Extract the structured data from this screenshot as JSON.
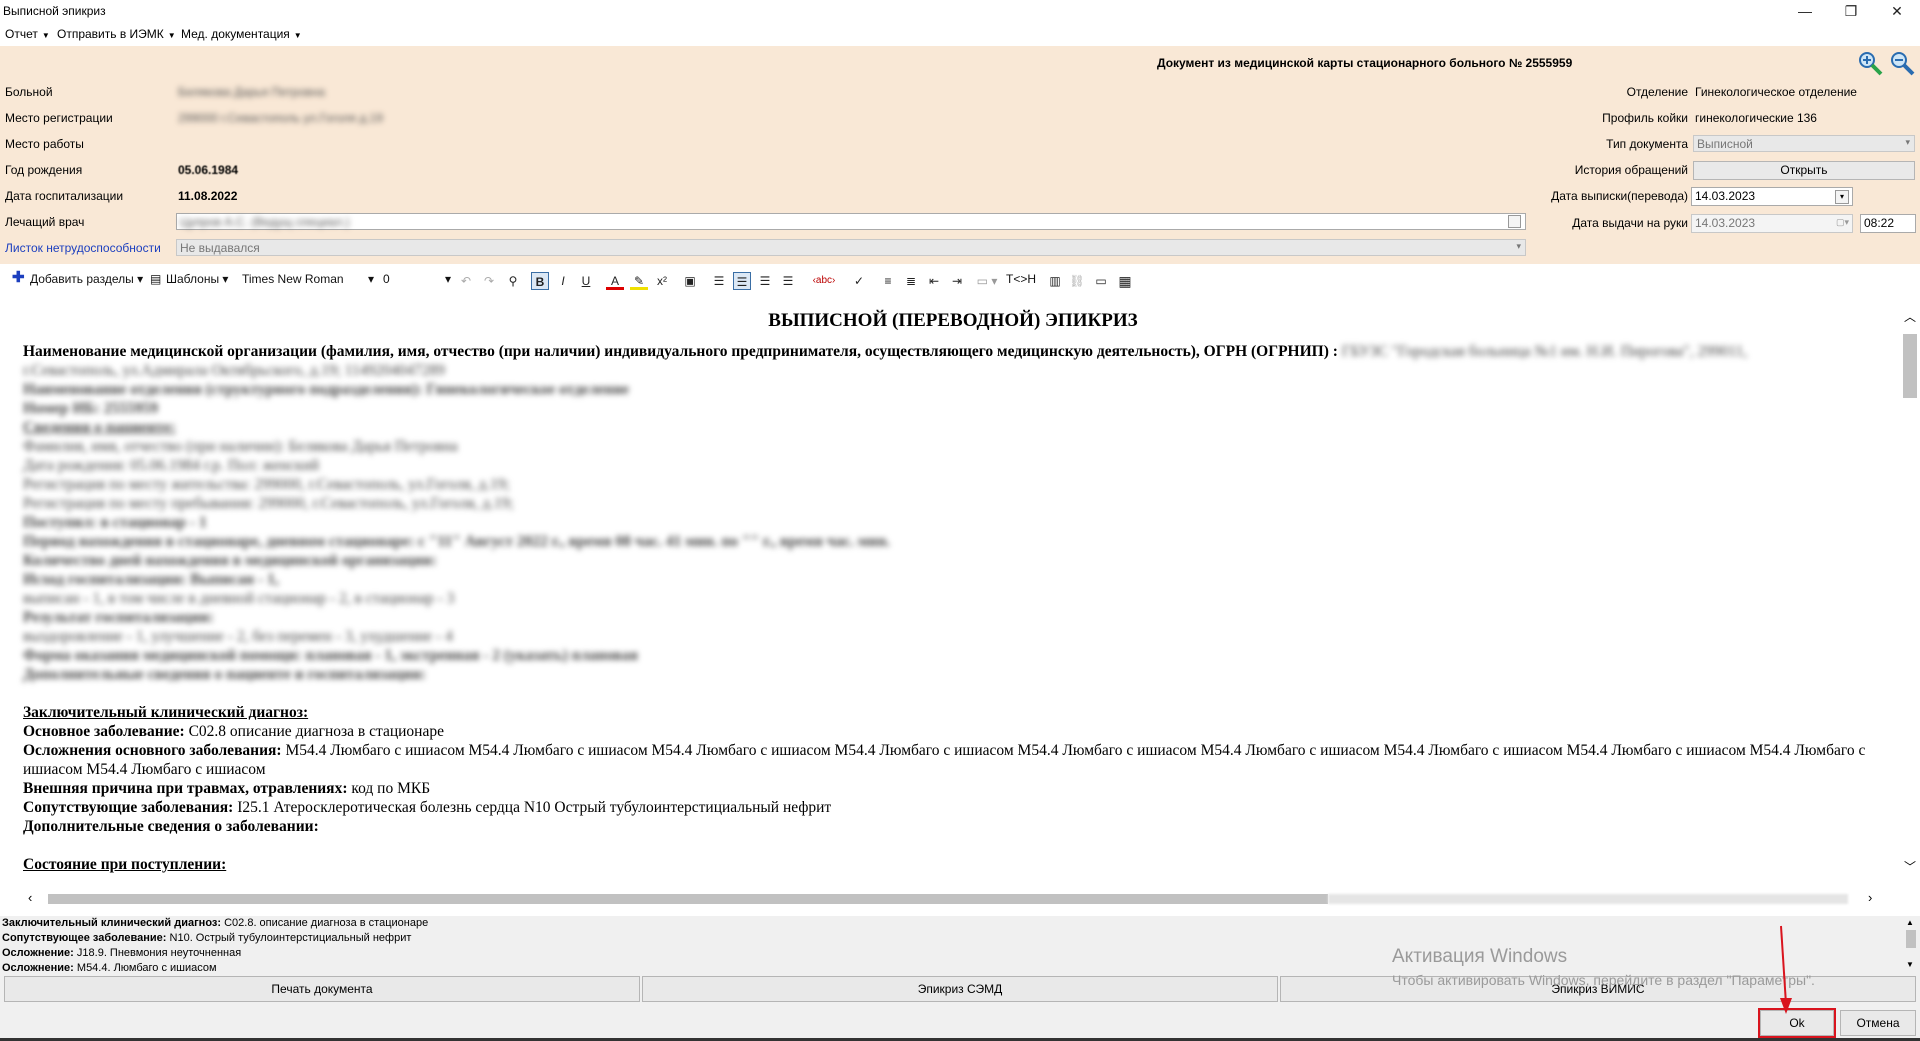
{
  "window": {
    "title": "Выписной эпикриз"
  },
  "menu": [
    {
      "label": "Отчет"
    },
    {
      "label": "Отправить в ИЭМК"
    },
    {
      "label": "Мед. документация"
    }
  ],
  "header": {
    "doc_title": "Документ из медицинской карты стационарного больного №  2555959",
    "labels": {
      "patient": "Больной",
      "reg_place": "Место регистрации",
      "work_place": "Место работы",
      "birth_year": "Год рождения",
      "hosp_date": "Дата госпитализации",
      "doctor": "Лечащий врач",
      "sick_leave": "Листок нетрудоспособности",
      "department": "Отделение",
      "bed_profile": "Профиль койки",
      "doc_type": "Тип документа",
      "history": "История обращений",
      "discharge_date": "Дата выписки(перевода)",
      "handout_date": "Дата выдачи на руки"
    },
    "values": {
      "patient": "Белякова Дарья Петровна",
      "reg_place": "299000 г.Севастополь ул.Гоголя д.19",
      "birth_year": "05.06.1984",
      "hosp_date": "11.08.2022",
      "doctor": "Цупров А.С. (Ведущ специал.)",
      "sick_leave": "Не выдавался",
      "department": "Гинекологическое отделение",
      "bed_profile": "гинекологические 136",
      "doc_type": "Выписной",
      "history_button": "Открыть",
      "discharge_date": "14.03.2023",
      "handout_date": "14.03.2023",
      "handout_time": "08:22"
    }
  },
  "toolbar": {
    "add_sections": "Добавить разделы",
    "templates": "Шаблоны",
    "font": "Times New Roman",
    "size": "0",
    "text_replace": "Т<>Н"
  },
  "document": {
    "heading": "ВЫПИСНОЙ (ПЕРЕВОДНОЙ) ЭПИКРИЗ",
    "org_label": "Наименование медицинской организации (фамилия, имя, отчество (при наличии) индивидуального предпринимателя, осуществляющего медицинскую деятельность), ОГРН (ОГРНИП) :",
    "org_value": "ГБУЗС \"Городская больница №1 им. Н.И. Пирогова\", 299011,",
    "blurred_lines": [
      "г.Севастополь, ул.Адмирала Октябрьского, д.19; 1149204047289",
      "Наименование отделения (структурного подразделения): Гинекологическое отделение",
      "Номер ИБ: 2555959",
      "Сведения о пациенте:",
      "Фамилия, имя, отчество (при наличии): Белякова Дарья Петровна",
      "Дата рождения: 05.06.1984 г.р. Пол: женский",
      "Регистрация по месту жительства: 299000, г.Севастополь, ул.Гоголя, д.19;",
      "Регистрация по месту пребывания: 299000, г.Севастополь, ул.Гоголя, д.19;",
      "Поступил: в стационар - 1",
      "Период нахождения в стационаре, дневном стационаре: с \"11\" Август 2022 г., время 08 час. 41 мин. по \"\" г., время час. мин.",
      "Количество дней нахождения в медицинской организации:",
      "Исход госпитализации: Выписан - 1,",
      "выписан - 1, в том числе в дневной стационар - 2, в стационар - 3",
      "Результат госпитализации:",
      "выздоровление - 1, улучшение - 2, без перемен - 3, ухудшение - 4",
      "Форма оказания медицинской помощи: плановая - 1, экстренная - 2 (указать) плановая",
      "Дополнительные сведения о пациенте и госпитализации:"
    ],
    "final_diag_title": "Заключительный клинический диагноз:",
    "main_disease_label": "Основное заболевание:",
    "main_disease_value": "C02.8 описание диагноза в стационаре",
    "complications_label": "Осложнения основного заболевания:",
    "complications_value": "M54.4 Люмбаго с ишиасом M54.4 Люмбаго с ишиасом M54.4 Люмбаго с ишиасом M54.4 Люмбаго с ишиасом M54.4 Люмбаго с ишиасом M54.4 Люмбаго с ишиасом M54.4 Люмбаго с ишиасом M54.4 Люмбаго с ишиасом M54.4 Люмбаго с ишиасом M54.4 Люмбаго с ишиасом",
    "external_label": "Внешняя причина при травмах, отравлениях:",
    "external_value": "код по МКБ",
    "concomitant_label": "Сопутствующие заболевания:",
    "concomitant_value": "I25.1 Атеросклеротическая болезнь сердца N10 Острый тубулоинтерстициальный нефрит",
    "additional_label": "Дополнительные сведения о заболевании:",
    "admission_label": "Состояние при поступлении:"
  },
  "info": [
    {
      "label": "Заключительный клинический диагноз:",
      "value": "C02.8. описание диагноза в стационаре"
    },
    {
      "label": "Сопутствующее заболевание:",
      "value": "N10. Острый тубулоинтерстициальный нефрит"
    },
    {
      "label": "Осложнение:",
      "value": "J18.9. Пневмония неуточненная"
    },
    {
      "label": "Осложнение:",
      "value": "M54.4. Люмбаго с ишиасом"
    }
  ],
  "buttons": {
    "print": "Печать документа",
    "semd": "Эпикриз СЭМД",
    "vimis": "Эпикриз ВИМИС",
    "ok": "Ok",
    "cancel": "Отмена"
  },
  "watermark": {
    "title": "Активация Windows",
    "subtitle": "Чтобы активировать Windows, перейдите в раздел \"Параметры\"."
  },
  "colors": {
    "header_bg": "#f9e8d6",
    "link_blue": "#1c3fbf",
    "highlight_red": "#d9141e"
  }
}
